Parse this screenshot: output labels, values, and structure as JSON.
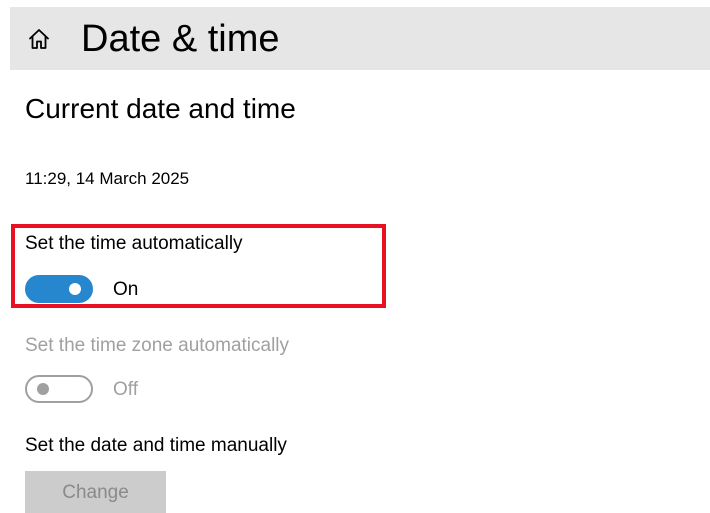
{
  "header": {
    "icon": "home-icon",
    "title": "Date & time",
    "background": "#e6e6e6"
  },
  "section": {
    "title": "Current date and time",
    "current_datetime": "11:29, 14 March 2025"
  },
  "settings": {
    "auto_time": {
      "label": "Set the time automatically",
      "state_label": "On",
      "enabled": true,
      "on": true
    },
    "auto_timezone": {
      "label": "Set the time zone automatically",
      "state_label": "Off",
      "enabled": false,
      "on": false
    },
    "manual": {
      "label": "Set the date and time manually",
      "button_label": "Change",
      "enabled": false
    }
  },
  "colors": {
    "accent": "#2687cf",
    "highlight": "#e81123",
    "disabled_text": "#a0a0a0"
  }
}
